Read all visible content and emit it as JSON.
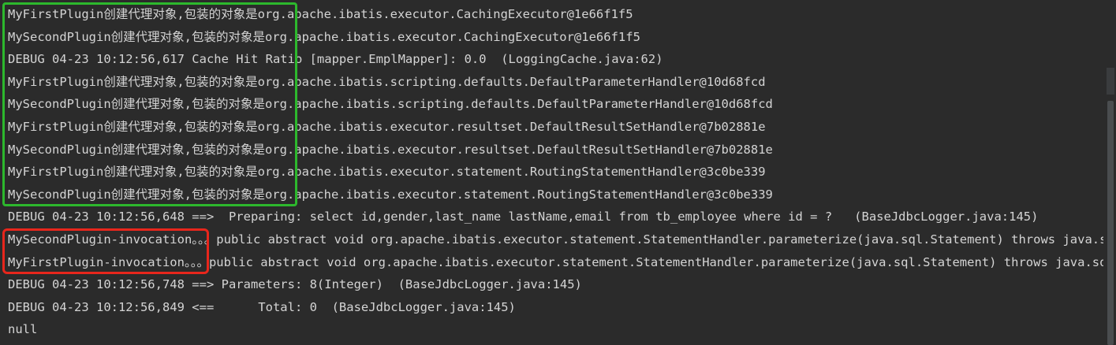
{
  "console": {
    "lines": [
      "MyFirstPlugin创建代理对象,包装的对象是org.apache.ibatis.executor.CachingExecutor@1e66f1f5",
      "MySecondPlugin创建代理对象,包装的对象是org.apache.ibatis.executor.CachingExecutor@1e66f1f5",
      "DEBUG 04-23 10:12:56,617 Cache Hit Ratio [mapper.EmplMapper]: 0.0  (LoggingCache.java:62)",
      "MyFirstPlugin创建代理对象,包装的对象是org.apache.ibatis.scripting.defaults.DefaultParameterHandler@10d68fcd",
      "MySecondPlugin创建代理对象,包装的对象是org.apache.ibatis.scripting.defaults.DefaultParameterHandler@10d68fcd",
      "MyFirstPlugin创建代理对象,包装的对象是org.apache.ibatis.executor.resultset.DefaultResultSetHandler@7b02881e",
      "MySecondPlugin创建代理对象,包装的对象是org.apache.ibatis.executor.resultset.DefaultResultSetHandler@7b02881e",
      "MyFirstPlugin创建代理对象,包装的对象是org.apache.ibatis.executor.statement.RoutingStatementHandler@3c0be339",
      "MySecondPlugin创建代理对象,包装的对象是org.apache.ibatis.executor.statement.RoutingStatementHandler@3c0be339",
      "DEBUG 04-23 10:12:56,648 ==>  Preparing: select id,gender,last_name lastName,email from tb_employee where id = ?   (BaseJdbcLogger.java:145)",
      "MySecondPlugin-invocation。。。public abstract void org.apache.ibatis.executor.statement.StatementHandler.parameterize(java.sql.Statement) throws java.sql.SQLException",
      "MyFirstPlugin-invocation。。。public abstract void org.apache.ibatis.executor.statement.StatementHandler.parameterize(java.sql.Statement) throws java.sql.SQLException",
      "DEBUG 04-23 10:12:56,748 ==> Parameters: 8(Integer)  (BaseJdbcLogger.java:145)",
      "DEBUG 04-23 10:12:56,849 <==      Total: 0  (BaseJdbcLogger.java:145)",
      "null"
    ]
  },
  "colors": {
    "background": "#2b2b2b",
    "text": "#d4d4d4",
    "highlight_green": "#2db82d",
    "highlight_red": "#e8261c"
  }
}
